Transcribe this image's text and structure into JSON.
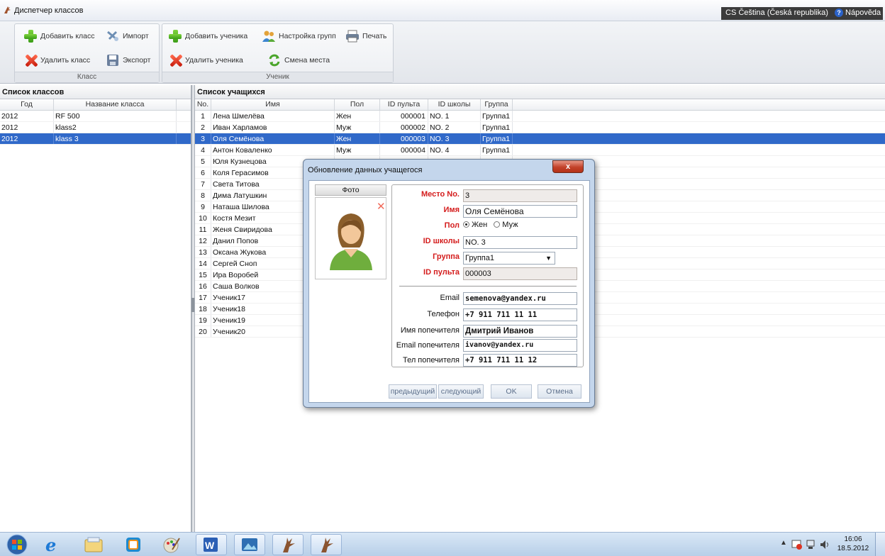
{
  "window": {
    "title": "Диспетчер классов"
  },
  "langbar": {
    "label": "CS Čeština (Česká republika)",
    "help": "Nápověda"
  },
  "ribbon": {
    "class_group": {
      "label": "Класс",
      "add": "Добавить класс",
      "delete": "Удалить класс",
      "import": "Импорт",
      "export": "Экспорт"
    },
    "student_group": {
      "label": "Ученик",
      "add": "Добавить ученика",
      "delete": "Удалить ученика",
      "groups": "Настройка групп",
      "seat": "Смена места",
      "print": "Печать"
    }
  },
  "class_list": {
    "title": "Список классов",
    "columns": [
      "Год",
      "Название класса"
    ],
    "rows": [
      {
        "year": "2012",
        "name": "RF 500"
      },
      {
        "year": "2012",
        "name": "klass2"
      },
      {
        "year": "2012",
        "name": "klass 3"
      }
    ],
    "selected_index": 2
  },
  "student_list": {
    "title": "Список учащихся",
    "columns": [
      "No.",
      "Имя",
      "Пол",
      "ID пульта",
      "ID школы",
      "Группа"
    ],
    "rows": [
      {
        "no": "1",
        "name": "Лена Шмелёва",
        "sex": "Жен",
        "pult": "000001",
        "school": "NO. 1",
        "group": "Группа1"
      },
      {
        "no": "2",
        "name": "Иван Харламов",
        "sex": "Муж",
        "pult": "000002",
        "school": "NO. 2",
        "group": "Группа1"
      },
      {
        "no": "3",
        "name": "Оля Семёнова",
        "sex": "Жен",
        "pult": "000003",
        "school": "NO. 3",
        "group": "Группа1"
      },
      {
        "no": "4",
        "name": "Антон Коваленко",
        "sex": "Муж",
        "pult": "000004",
        "school": "NO. 4",
        "group": "Группа1"
      },
      {
        "no": "5",
        "name": "Юля Кузнецова"
      },
      {
        "no": "6",
        "name": "Коля Герасимов"
      },
      {
        "no": "7",
        "name": "Света Титова"
      },
      {
        "no": "8",
        "name": "Дима Латушкин"
      },
      {
        "no": "9",
        "name": "Наташа Шилова"
      },
      {
        "no": "10",
        "name": "Костя Мезит"
      },
      {
        "no": "11",
        "name": "Женя Свиридова"
      },
      {
        "no": "12",
        "name": "Данил Попов"
      },
      {
        "no": "13",
        "name": "Оксана Жукова"
      },
      {
        "no": "14",
        "name": "Сергей Сноп"
      },
      {
        "no": "15",
        "name": "Ира Воробей"
      },
      {
        "no": "16",
        "name": "Саша Волков"
      },
      {
        "no": "17",
        "name": "Ученик17"
      },
      {
        "no": "18",
        "name": "Ученик18"
      },
      {
        "no": "19",
        "name": "Ученик19"
      },
      {
        "no": "20",
        "name": "Ученик20"
      }
    ],
    "selected_index": 2
  },
  "dialog": {
    "title": "Обновление данных учащегося",
    "close": "x",
    "photo_label": "Фото",
    "photo_delete": "✕",
    "seat_label": "Место No.",
    "seat_value": "3",
    "name_label": "Имя",
    "name_value": "Оля Семёнова",
    "sex_label": "Пол",
    "sex_female": "Жен",
    "sex_male": "Муж",
    "school_label": "ID школы",
    "school_value": "NO. 3",
    "group_label": "Группа",
    "group_value": "Группа1",
    "pult_label": "ID пульта",
    "pult_value": "000003",
    "email_label": "Email",
    "email_value": "semenova@yandex.ru",
    "phone_label": "Телефон",
    "phone_value": "+7 911 711 11 11",
    "guardian_label": "Имя попечителя",
    "guardian_value": "Дмитрий Иванов",
    "guardian_email_label": "Email попечителя",
    "guardian_email_value": "ivanov@yandex.ru",
    "guardian_phone_label": "Тел попечителя",
    "guardian_phone_value": "+7 911 711 11 12",
    "prev": "предыдущий",
    "next": "следующий",
    "ok": "OK",
    "cancel": "Отмена"
  },
  "taskbar": {
    "time": "16:06",
    "date": "18.5.2012"
  }
}
